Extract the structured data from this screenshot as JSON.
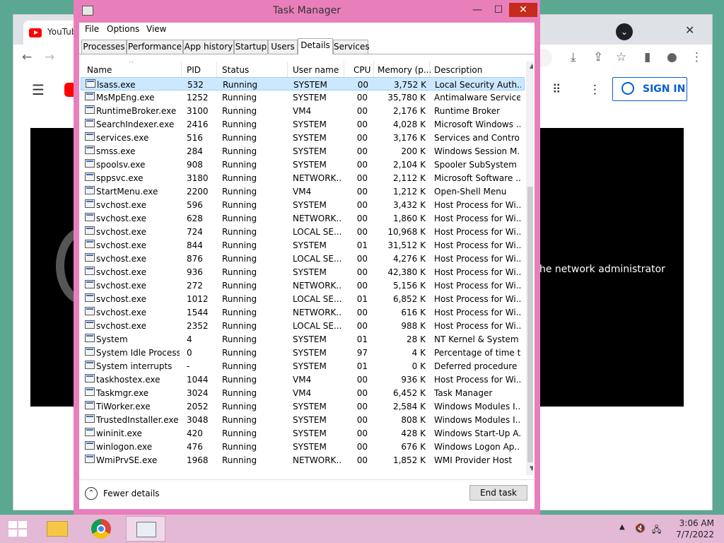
{
  "browser": {
    "tab_title": "YouTube",
    "signin_label": "SIGN IN",
    "video_message": "he network administrator"
  },
  "window": {
    "title": "Task Manager",
    "menu": [
      "File",
      "Options",
      "View"
    ],
    "tabs": [
      "Processes",
      "Performance",
      "App history",
      "Startup",
      "Users",
      "Details",
      "Services"
    ],
    "active_tab": "Details"
  },
  "table": {
    "headers": [
      "Name",
      "PID",
      "Status",
      "User name",
      "CPU",
      "Memory (p...",
      "Description"
    ],
    "rows": [
      [
        "lsass.exe",
        "532",
        "Running",
        "SYSTEM",
        "00",
        "3,752 K",
        "Local Security Auth..."
      ],
      [
        "MsMpEng.exe",
        "1252",
        "Running",
        "SYSTEM",
        "00",
        "35,780 K",
        "Antimalware Service..."
      ],
      [
        "RuntimeBroker.exe",
        "3100",
        "Running",
        "VM4",
        "00",
        "2,176 K",
        "Runtime Broker"
      ],
      [
        "SearchIndexer.exe",
        "2416",
        "Running",
        "SYSTEM",
        "00",
        "4,028 K",
        "Microsoft Windows ..."
      ],
      [
        "services.exe",
        "516",
        "Running",
        "SYSTEM",
        "00",
        "3,176 K",
        "Services and Control..."
      ],
      [
        "smss.exe",
        "284",
        "Running",
        "SYSTEM",
        "00",
        "200 K",
        "Windows Session M..."
      ],
      [
        "spoolsv.exe",
        "908",
        "Running",
        "SYSTEM",
        "00",
        "2,104 K",
        "Spooler SubSystem ..."
      ],
      [
        "sppsvc.exe",
        "3180",
        "Running",
        "NETWORK...",
        "00",
        "2,112 K",
        "Microsoft Software ..."
      ],
      [
        "StartMenu.exe",
        "2200",
        "Running",
        "VM4",
        "00",
        "1,212 K",
        "Open-Shell Menu"
      ],
      [
        "svchost.exe",
        "596",
        "Running",
        "SYSTEM",
        "00",
        "3,432 K",
        "Host Process for Wi..."
      ],
      [
        "svchost.exe",
        "628",
        "Running",
        "NETWORK...",
        "00",
        "1,860 K",
        "Host Process for Wi..."
      ],
      [
        "svchost.exe",
        "724",
        "Running",
        "LOCAL SE...",
        "00",
        "10,968 K",
        "Host Process for Wi..."
      ],
      [
        "svchost.exe",
        "844",
        "Running",
        "SYSTEM",
        "01",
        "31,512 K",
        "Host Process for Wi..."
      ],
      [
        "svchost.exe",
        "876",
        "Running",
        "LOCAL SE...",
        "00",
        "4,276 K",
        "Host Process for Wi..."
      ],
      [
        "svchost.exe",
        "936",
        "Running",
        "SYSTEM",
        "00",
        "42,380 K",
        "Host Process for Wi..."
      ],
      [
        "svchost.exe",
        "272",
        "Running",
        "NETWORK...",
        "00",
        "5,156 K",
        "Host Process for Wi..."
      ],
      [
        "svchost.exe",
        "1012",
        "Running",
        "LOCAL SE...",
        "01",
        "6,852 K",
        "Host Process for Wi..."
      ],
      [
        "svchost.exe",
        "1544",
        "Running",
        "NETWORK...",
        "00",
        "616 K",
        "Host Process for Wi..."
      ],
      [
        "svchost.exe",
        "2352",
        "Running",
        "LOCAL SE...",
        "00",
        "988 K",
        "Host Process for Wi..."
      ],
      [
        "System",
        "4",
        "Running",
        "SYSTEM",
        "01",
        "28 K",
        "NT Kernel & System"
      ],
      [
        "System Idle Process",
        "0",
        "Running",
        "SYSTEM",
        "97",
        "4 K",
        "Percentage of time t..."
      ],
      [
        "System interrupts",
        "-",
        "Running",
        "SYSTEM",
        "01",
        "0 K",
        "Deferred procedure ..."
      ],
      [
        "taskhostex.exe",
        "1044",
        "Running",
        "VM4",
        "00",
        "936 K",
        "Host Process for Wi..."
      ],
      [
        "Taskmgr.exe",
        "3024",
        "Running",
        "VM4",
        "00",
        "6,452 K",
        "Task Manager"
      ],
      [
        "TiWorker.exe",
        "2052",
        "Running",
        "SYSTEM",
        "00",
        "2,584 K",
        "Windows Modules I..."
      ],
      [
        "TrustedInstaller.exe",
        "3048",
        "Running",
        "SYSTEM",
        "00",
        "808 K",
        "Windows Modules I..."
      ],
      [
        "wininit.exe",
        "420",
        "Running",
        "SYSTEM",
        "00",
        "428 K",
        "Windows Start-Up A..."
      ],
      [
        "winlogon.exe",
        "476",
        "Running",
        "SYSTEM",
        "00",
        "676 K",
        "Windows Logon Ap..."
      ],
      [
        "WmiPrvSE.exe",
        "1968",
        "Running",
        "NETWORK...",
        "00",
        "1,852 K",
        "WMI Provider Host"
      ]
    ],
    "selected_row": 0
  },
  "footer": {
    "fewer_details": "Fewer details",
    "end_task": "End task"
  },
  "taskbar": {
    "time": "3:06 AM",
    "date": "7/7/2022"
  }
}
